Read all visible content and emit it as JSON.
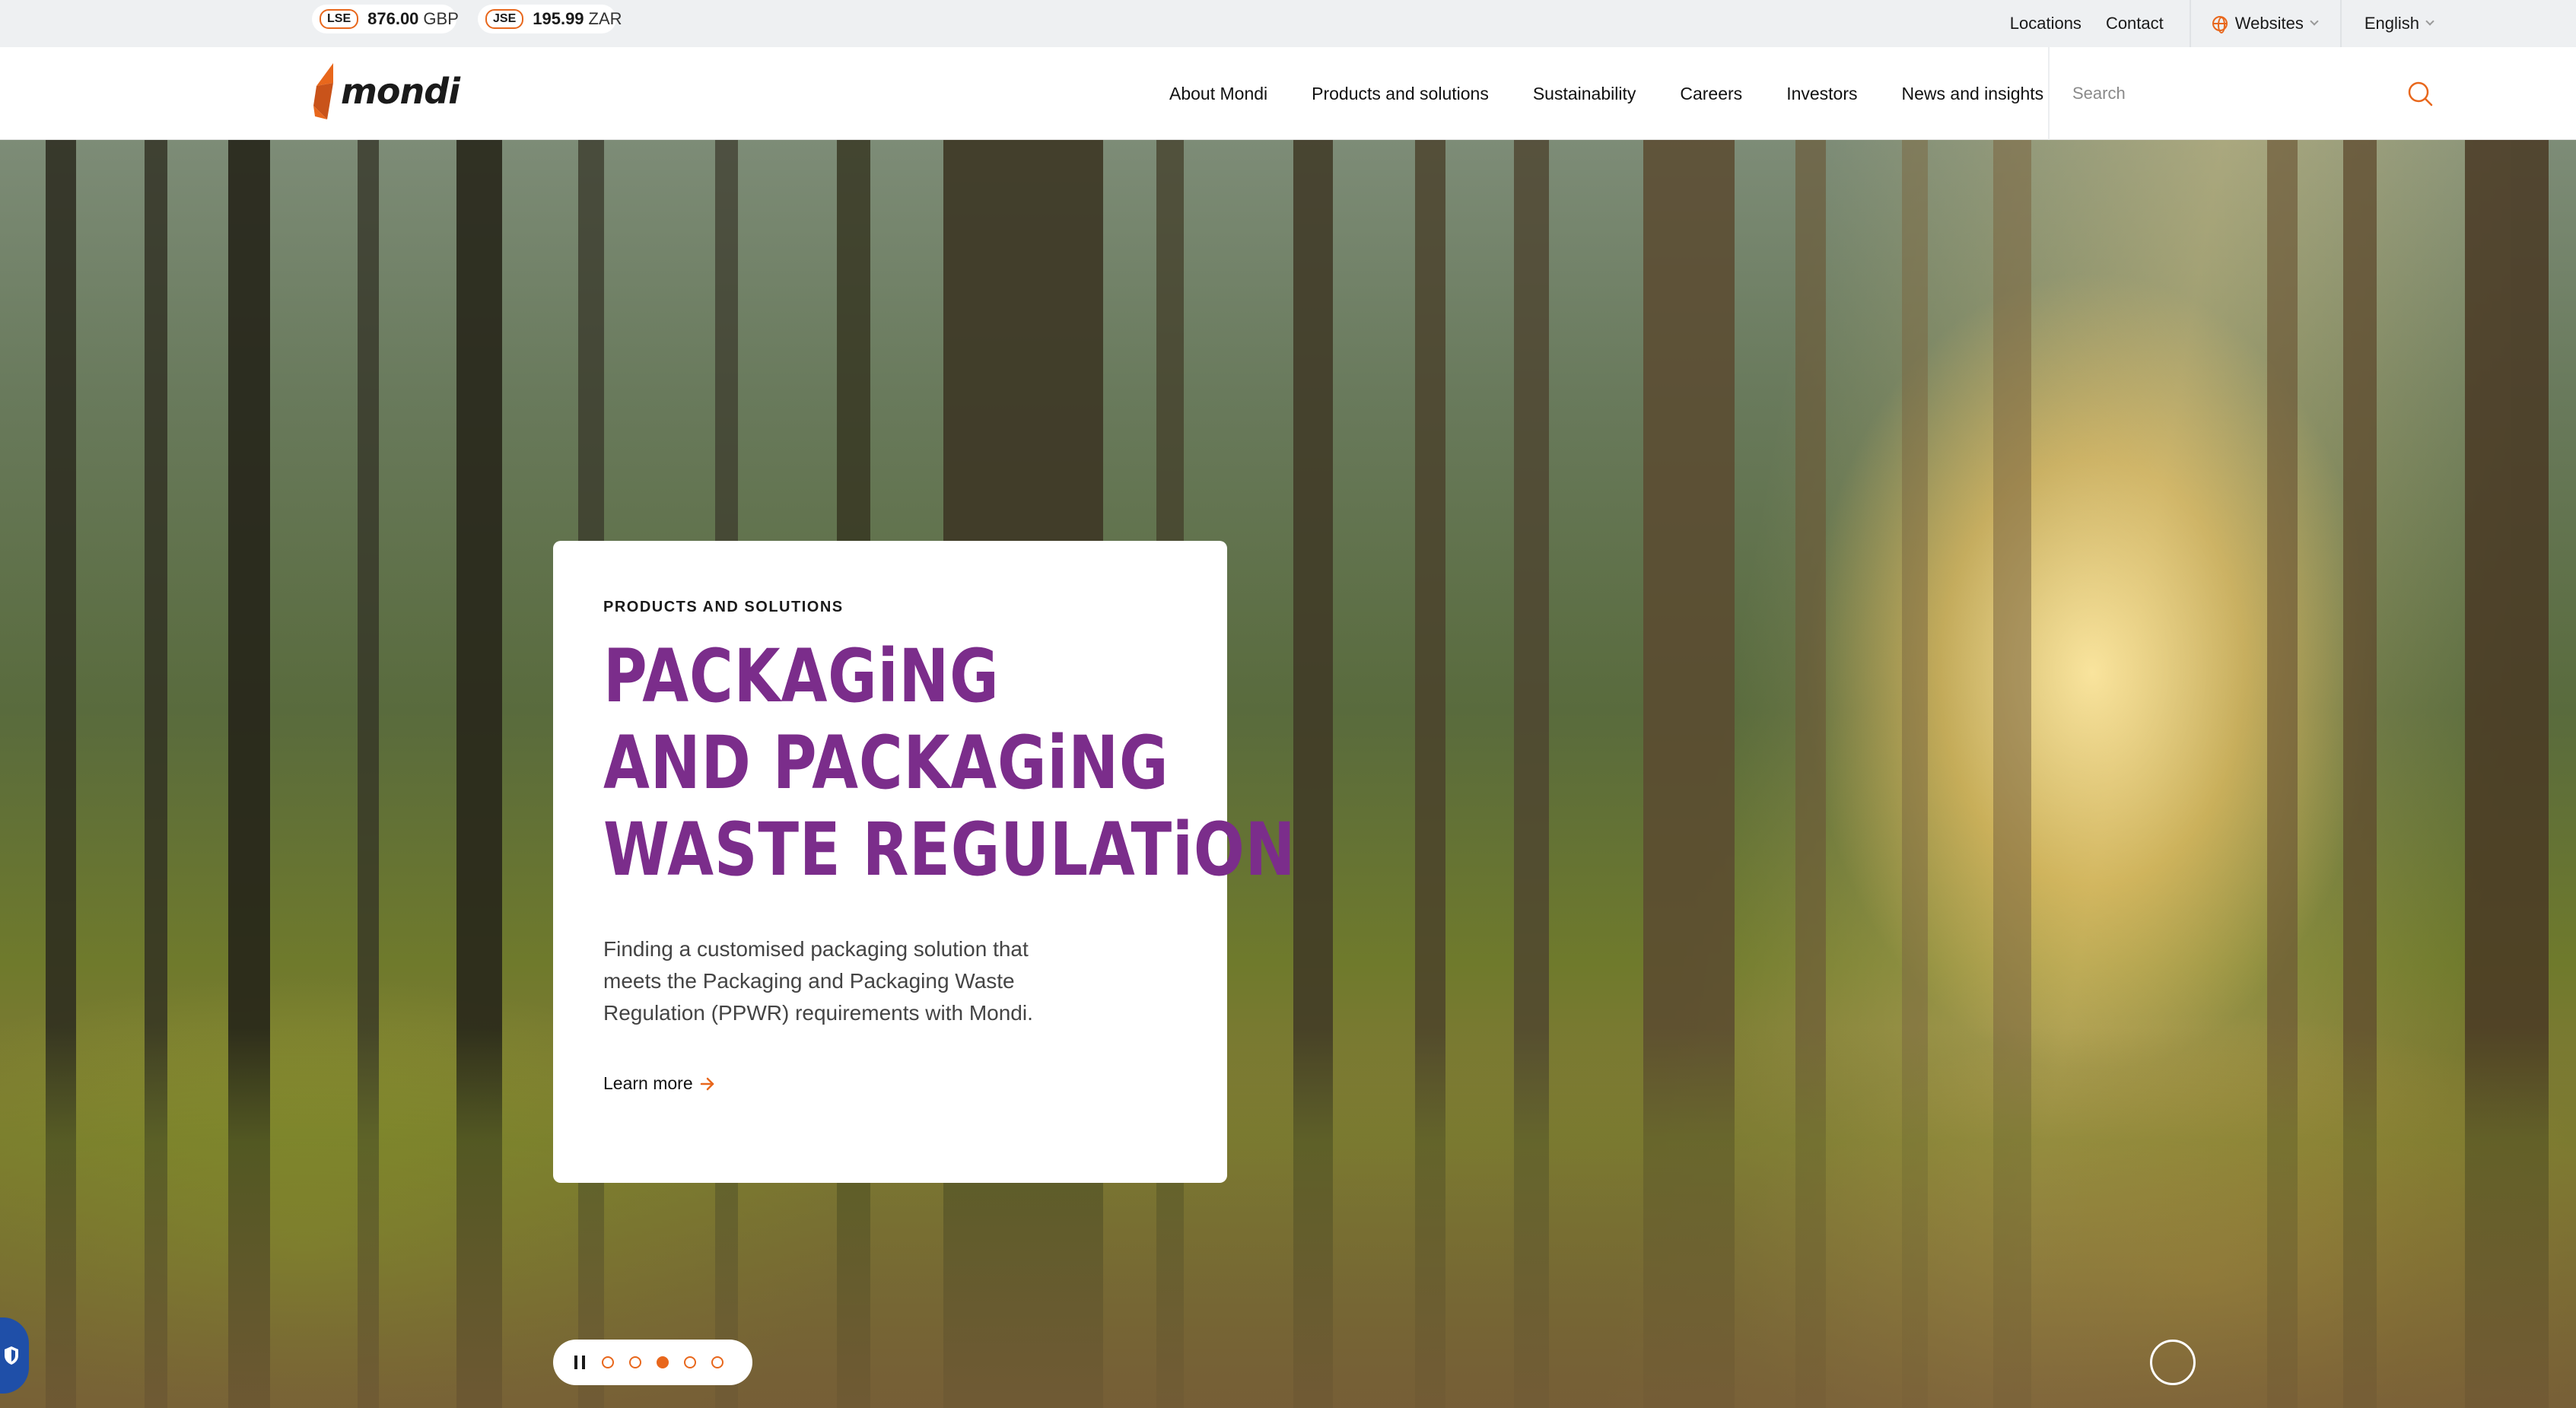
{
  "colors": {
    "accent": "#e8671c",
    "title_purple": "#7b2d8b",
    "utility_bg": "#eef0f2",
    "privacy_blue": "#1f4fa8"
  },
  "stock_tickers": [
    {
      "exchange": "LSE",
      "price": "876.00",
      "currency": "GBP"
    },
    {
      "exchange": "JSE",
      "price": "195.99",
      "currency": "ZAR"
    }
  ],
  "utility_links": {
    "locations": "Locations",
    "contact": "Contact",
    "websites": "Websites",
    "websites_icon": "globe-icon",
    "language": "English"
  },
  "logo": {
    "text": "mondi"
  },
  "nav": {
    "items": [
      "About Mondi",
      "Products and solutions",
      "Sustainability",
      "Careers",
      "Investors",
      "News and insights"
    ]
  },
  "search": {
    "placeholder": "Search",
    "value": "",
    "icon": "search-icon"
  },
  "hero": {
    "eyebrow": "PRODUCTS AND SOLUTIONS",
    "title_lines": [
      "PACKAGiNG",
      "AND PACKAGiNG",
      "WASTE REGULATiON"
    ],
    "description": "Finding a customised packaging solution that meets the Packaging and Packaging Waste Regulation (PPWR) requirements with Mondi.",
    "cta_label": "Learn more",
    "cta_icon": "arrow-right-icon"
  },
  "carousel": {
    "slide_count": 5,
    "active_slide": 3,
    "pause_icon": "pause-icon"
  }
}
